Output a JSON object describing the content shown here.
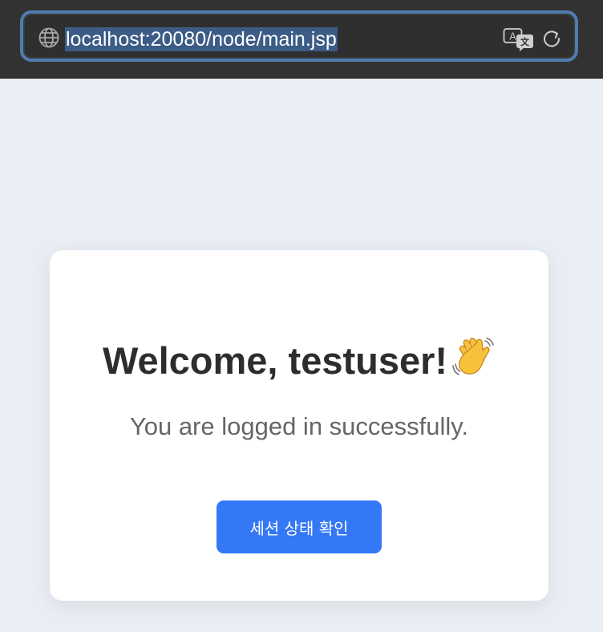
{
  "browser": {
    "url": "localhost:20080/node/main.jsp",
    "icons": {
      "site": "globe-icon",
      "translate": "translate-icon",
      "reload": "reload-icon"
    },
    "colors": {
      "toolbar": "#323232",
      "focus_ring": "#4f7eae",
      "selection": "#3c5c86"
    }
  },
  "page": {
    "background": "#e8eef3",
    "card": {
      "title": "Welcome, testuser!",
      "title_icon": "waving-hand-icon",
      "subtitle": "You are logged in successfully.",
      "button_label": "세션 상태 확인",
      "button_color": "#3478f6"
    }
  }
}
